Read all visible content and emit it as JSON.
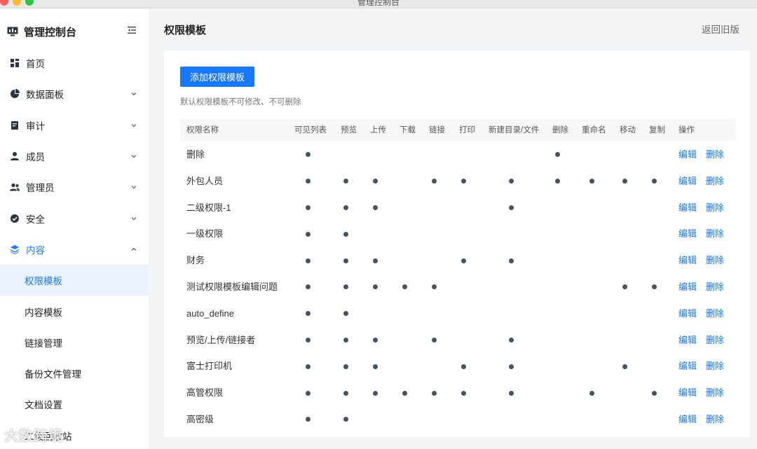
{
  "window": {
    "title": "管理控制台"
  },
  "sidebar": {
    "brand": "管理控制台",
    "items": [
      {
        "label": "首页",
        "icon": "dashboard-icon",
        "expandable": false
      },
      {
        "label": "数据面板",
        "icon": "pie-chart-icon",
        "expandable": true
      },
      {
        "label": "审计",
        "icon": "audit-icon",
        "expandable": true
      },
      {
        "label": "成员",
        "icon": "user-icon",
        "expandable": true
      },
      {
        "label": "管理员",
        "icon": "admin-icon",
        "expandable": true
      },
      {
        "label": "安全",
        "icon": "safety-icon",
        "expandable": true
      },
      {
        "label": "内容",
        "icon": "layers-icon",
        "expandable": true,
        "expanded": true
      }
    ],
    "subitems": [
      {
        "label": "权限模板",
        "selected": true
      },
      {
        "label": "内容模板"
      },
      {
        "label": "链接管理"
      },
      {
        "label": "备份文件管理"
      },
      {
        "label": "文档设置"
      },
      {
        "label": "二级回收站"
      }
    ]
  },
  "header": {
    "title": "权限模板",
    "back_link": "返回旧版"
  },
  "main": {
    "add_button": "添加权限模板",
    "hint": "默认权限模板不可修改、不可删除"
  },
  "table": {
    "columns": [
      "权限名称",
      "可见列表",
      "预览",
      "上传",
      "下载",
      "链接",
      "打印",
      "新建目录/文件",
      "删除",
      "重命名",
      "移动",
      "复制",
      "操作"
    ],
    "edit_label": "编辑",
    "delete_label": "删除",
    "rows": [
      {
        "name": "删除",
        "perms": [
          1,
          0,
          0,
          0,
          0,
          0,
          0,
          1,
          0,
          0,
          0
        ]
      },
      {
        "name": "外包人员",
        "perms": [
          1,
          1,
          1,
          0,
          1,
          1,
          1,
          1,
          1,
          1,
          1
        ]
      },
      {
        "name": "二级权限-1",
        "perms": [
          1,
          1,
          1,
          0,
          0,
          0,
          1,
          0,
          0,
          0,
          0
        ]
      },
      {
        "name": "一级权限",
        "perms": [
          1,
          1,
          0,
          0,
          0,
          0,
          0,
          0,
          0,
          0,
          0
        ]
      },
      {
        "name": "财务",
        "perms": [
          1,
          1,
          1,
          0,
          0,
          1,
          1,
          0,
          0,
          0,
          0
        ]
      },
      {
        "name": "测试权限模板编辑问题",
        "perms": [
          1,
          1,
          1,
          1,
          1,
          0,
          0,
          0,
          0,
          1,
          1
        ]
      },
      {
        "name": "auto_define",
        "perms": [
          1,
          1,
          0,
          0,
          0,
          0,
          0,
          0,
          0,
          0,
          0
        ]
      },
      {
        "name": "预览/上传/链接者",
        "perms": [
          1,
          1,
          1,
          0,
          1,
          0,
          1,
          0,
          0,
          0,
          0
        ]
      },
      {
        "name": "富士打印机",
        "perms": [
          1,
          1,
          1,
          0,
          0,
          1,
          1,
          0,
          0,
          1,
          0
        ]
      },
      {
        "name": "高管权限",
        "perms": [
          1,
          1,
          1,
          1,
          1,
          1,
          1,
          0,
          1,
          0,
          1
        ]
      },
      {
        "name": "高密级",
        "perms": [
          1,
          1,
          0,
          0,
          0,
          0,
          0,
          0,
          0,
          0,
          0
        ]
      }
    ]
  },
  "watermark": "大数跨境"
}
